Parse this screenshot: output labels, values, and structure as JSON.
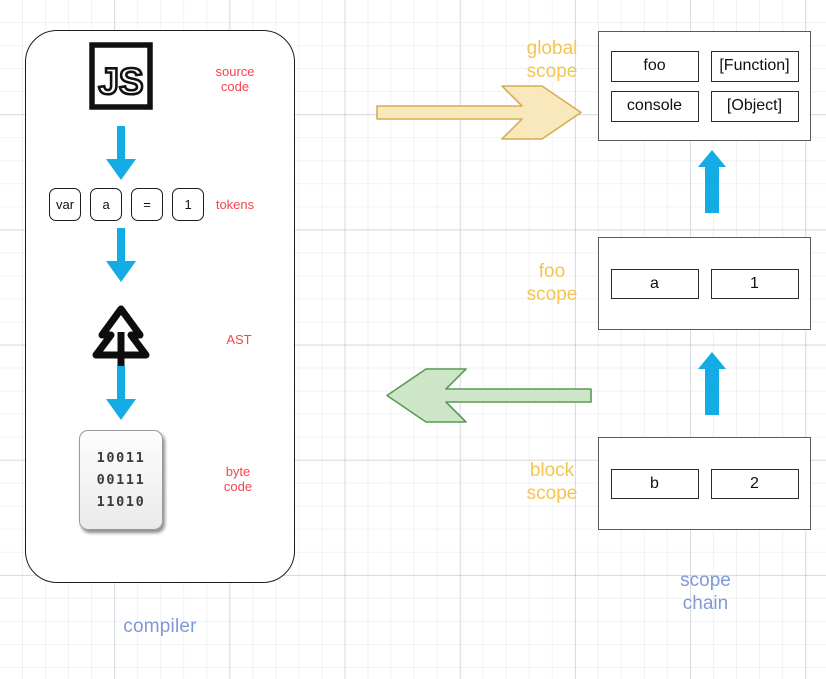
{
  "compiler": {
    "label": "compiler",
    "source_code_label": "source\ncode",
    "tokens_label": "tokens",
    "ast_label": "AST",
    "bytecode_label": "byte\ncode",
    "logo_text": "JS",
    "tokens": [
      "var",
      "a",
      "=",
      "1"
    ],
    "bytecode_lines": [
      "10011",
      "00111",
      "11010"
    ],
    "icons": {
      "source": "js-logo-icon",
      "ast": "pine-tree-icon"
    }
  },
  "scope_chain": {
    "label": "scope\nchain",
    "scopes": [
      {
        "label": "global\nscope",
        "name": "global",
        "entries": [
          {
            "key": "foo",
            "value": "[Function]"
          },
          {
            "key": "console",
            "value": "[Object]"
          }
        ]
      },
      {
        "label": "foo\nscope",
        "name": "foo",
        "entries": [
          {
            "key": "a",
            "value": "1"
          }
        ]
      },
      {
        "label": "block\nscope",
        "name": "block",
        "entries": [
          {
            "key": "b",
            "value": "2"
          }
        ]
      }
    ]
  },
  "arrows": {
    "compile_to_global": "right-arrow",
    "lookup_back": "left-arrow",
    "chain_up_global": "up-arrow",
    "chain_up_foo": "up-arrow",
    "pipeline": [
      "down-arrow",
      "down-arrow",
      "down-arrow"
    ]
  },
  "colors": {
    "stage_label": "#f4444c",
    "scope_label": "#f5c451",
    "section_label": "#8098d8",
    "pipeline_arrow": "#13ace4",
    "right_arrow_fill": "#f9e8bc",
    "right_arrow_stroke": "#d4ae54",
    "left_arrow_fill": "#cde6c8",
    "left_arrow_stroke": "#5a9a52"
  }
}
